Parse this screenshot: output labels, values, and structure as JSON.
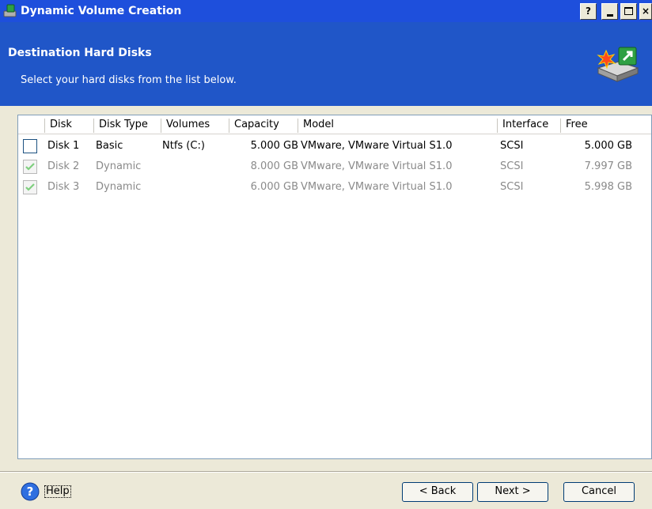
{
  "window": {
    "title": "Dynamic Volume Creation",
    "help_btn": "?"
  },
  "header": {
    "title": "Destination Hard Disks",
    "subtitle": "Select your hard disks from the list below."
  },
  "columns": [
    "Disk",
    "Disk Type",
    "Volumes",
    "Capacity",
    "Model",
    "Interface",
    "Free"
  ],
  "disks": [
    {
      "checked": false,
      "enabled": true,
      "disk": "Disk 1",
      "type": "Basic",
      "volumes": "Ntfs (C:)",
      "capacity": "5.000 GB",
      "model": "VMware, VMware Virtual S1.0",
      "interface": "SCSI",
      "free": "5.000 GB"
    },
    {
      "checked": true,
      "enabled": false,
      "disk": "Disk 2",
      "type": "Dynamic",
      "volumes": "",
      "capacity": "8.000 GB",
      "model": "VMware, VMware Virtual S1.0",
      "interface": "SCSI",
      "free": "7.997 GB"
    },
    {
      "checked": true,
      "enabled": false,
      "disk": "Disk 3",
      "type": "Dynamic",
      "volumes": "",
      "capacity": "6.000 GB",
      "model": "VMware, VMware Virtual S1.0",
      "interface": "SCSI",
      "free": "5.998 GB"
    }
  ],
  "footer": {
    "help": "Help",
    "back": "< Back",
    "next": "Next >",
    "cancel": "Cancel"
  },
  "colors": {
    "titlebar": "#1e4fdc",
    "header": "#2056c8",
    "check": "#3fbf3f"
  }
}
